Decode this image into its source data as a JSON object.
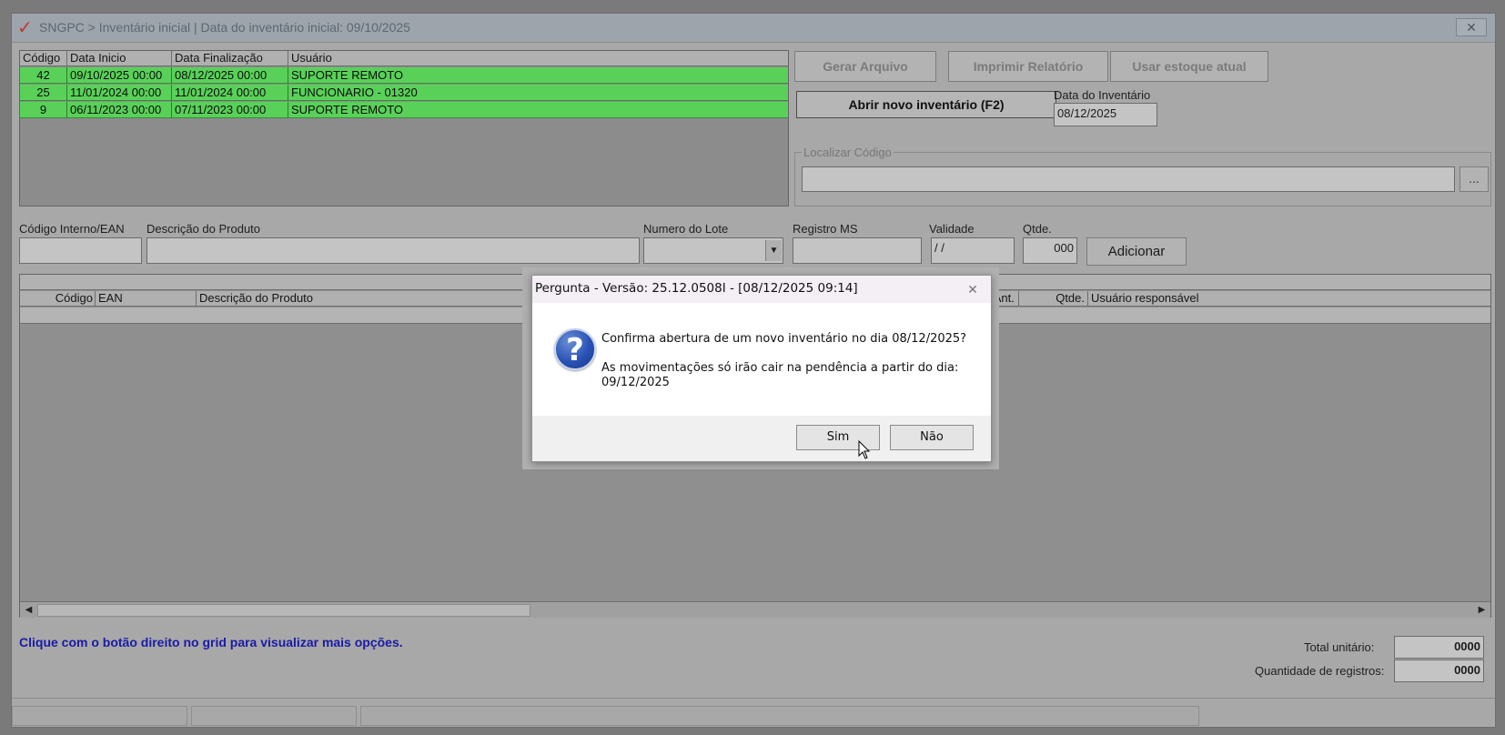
{
  "window": {
    "title": "SNGPC > Inventário inicial  |  Data do inventário inicial: 09/10/2025",
    "logo_glyph": "✓",
    "close_glyph": "✕"
  },
  "inventory_grid": {
    "columns": [
      "Código",
      "Data Inicio",
      "Data Finalização",
      "Usuário"
    ],
    "rows": [
      {
        "codigo": "42",
        "inicio": "09/10/2025 00:00",
        "fim": "08/12/2025 00:00",
        "usuario": "SUPORTE REMOTO"
      },
      {
        "codigo": "25",
        "inicio": "11/01/2024 00:00",
        "fim": "11/01/2024 00:00",
        "usuario": "FUNCIONARIO - 01320"
      },
      {
        "codigo": "9",
        "inicio": "06/11/2023 00:00",
        "fim": "07/11/2023 00:00",
        "usuario": "SUPORTE REMOTO"
      }
    ],
    "row_color": "#59d159"
  },
  "actions": {
    "gerar_arquivo": "Gerar Arquivo",
    "imprimir_relatorio": "Imprimir Relatório",
    "usar_estoque_atual": "Usar estoque atual",
    "abrir_novo_inventario": "Abrir novo inventário (F2)",
    "data_inventario_label": "Data do Inventário",
    "data_inventario_value": "08/12/2025"
  },
  "localizar": {
    "label": "Localizar Código",
    "value": "",
    "browse_label": "..."
  },
  "product_form": {
    "codigo_label": "Código Interno/EAN",
    "descricao_label": "Descrição do Produto",
    "lote_label": "Numero do Lote",
    "registro_label": "Registro MS",
    "validade_label": "Validade",
    "validade_value": " / /",
    "qtde_label": "Qtde.",
    "qtde_value": "000",
    "adicionar_label": "Adicionar"
  },
  "items_grid": {
    "columns": [
      "Código",
      "EAN",
      "Descrição do Produto",
      "Qtde. Ant.",
      "Qtde.",
      "Usuário responsável"
    ]
  },
  "footer": {
    "hint": "Clique com o botão direito no grid para visualizar mais opções.",
    "total_unitario_label": "Total unitário:",
    "total_unitario_value": "0000",
    "quantidade_registros_label": "Quantidade de registros:",
    "quantidade_registros_value": "0000"
  },
  "dialog": {
    "title": "Pergunta - Versão: 25.12.0508I - [08/12/2025 09:14]",
    "icon": "question-icon",
    "icon_glyph": "?",
    "line1": "Confirma abertura de um novo inventário no dia 08/12/2025?",
    "line2": "As movimentações só irão cair na pendência a partir do dia:",
    "line3": "09/12/2025",
    "yes_label": "Sim",
    "no_label": "Não",
    "close_glyph": "✕"
  }
}
